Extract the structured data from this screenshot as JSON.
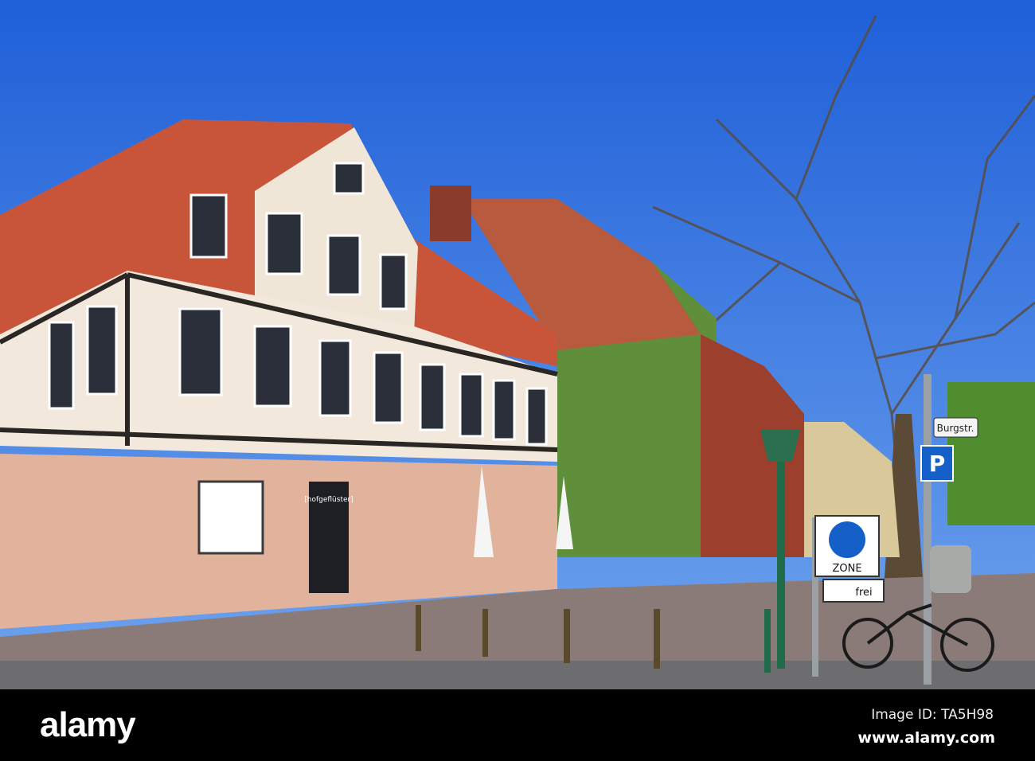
{
  "photo": {
    "shop_sign": "[hofgeflüster]",
    "street_sign": "Burgstr.",
    "parking_sign": "P",
    "zone_sign": "ZONE",
    "bike_sign": "frei"
  },
  "watermark": {
    "logo": "alamy",
    "image_id": "Image ID: TA5H98",
    "site": "www.alamy.com"
  },
  "colors": {
    "sky": "#2f6fe0",
    "roof": "#c8553a",
    "sign_blue": "#1560c8"
  }
}
